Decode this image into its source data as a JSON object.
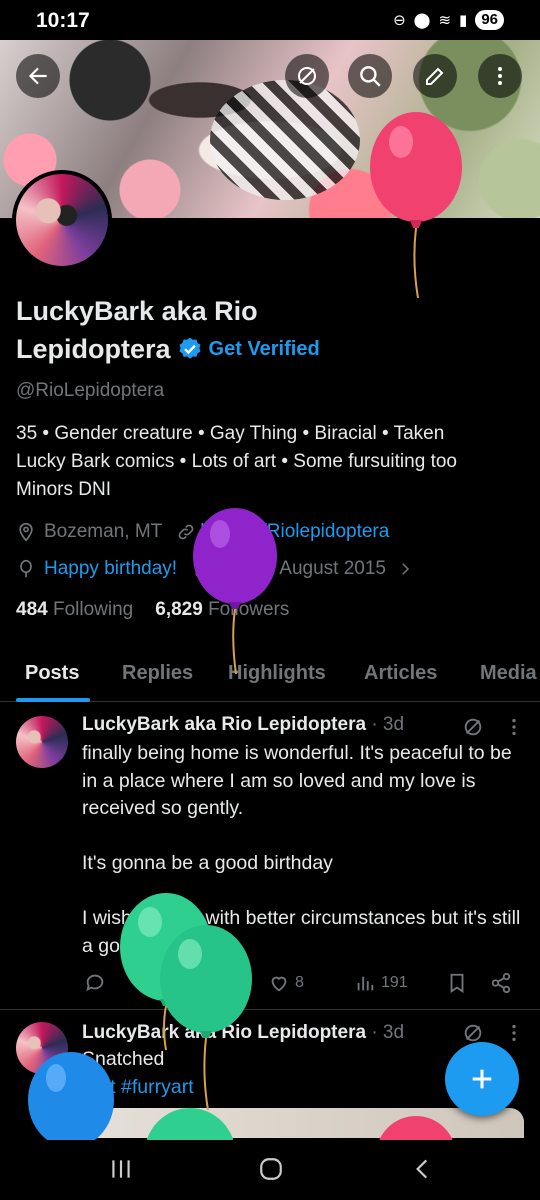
{
  "status": {
    "time": "10:17",
    "battery": "96"
  },
  "profile": {
    "name": "LuckyBark aka Rio Lepidoptera",
    "name_line1": "LuckyBark aka Rio",
    "name_line2": "Lepidoptera",
    "get_verified": "Get Verified",
    "handle": "@RioLepidoptera",
    "bio_line1": "35 • Gender creature • Gay Thing • Biracial • Taken",
    "bio_line2": "Lucky Bark comics • Lots of art • Some fursuiting too",
    "bio_line3": "Minors DNI",
    "location": "Bozeman, MT",
    "link": "linktree/Riolepidoptera",
    "birthday": "Happy birthday!",
    "joined": "Joined August 2015",
    "following_count": "484",
    "following_label": "Following",
    "followers_count": "6,829",
    "followers_label": "Followers"
  },
  "tabs": [
    "Posts",
    "Replies",
    "Highlights",
    "Articles",
    "Media"
  ],
  "posts": [
    {
      "author": "LuckyBark aka Rio Lepidoptera",
      "date": "· 3d",
      "text": "finally being home is wonderful. It's peaceful to be in a place where I am so loved and my love is received so gently.\n\nIt's gonna be a good birthday\n\nI wish it came with better circumstances but it's still a good one.",
      "likes": "8",
      "views": "191"
    },
    {
      "author": "LuckyBark aka Rio Lepidoptera",
      "date": "· 3d",
      "text": "Snatched",
      "hashtags": "#art #furryart"
    }
  ],
  "colors": {
    "accent": "#1d9bf0",
    "muted": "#71767b",
    "background": "#000000"
  },
  "icons": [
    "back-arrow-icon",
    "grok-icon",
    "search-icon",
    "edit-icon",
    "more-vertical-icon",
    "location-icon",
    "link-icon",
    "balloon-icon",
    "calendar-icon",
    "chevron-right-icon",
    "reply-icon",
    "repost-icon",
    "like-icon",
    "views-icon",
    "bookmark-icon",
    "share-icon",
    "plus-icon",
    "recent-apps-icon",
    "home-icon",
    "back-icon"
  ]
}
